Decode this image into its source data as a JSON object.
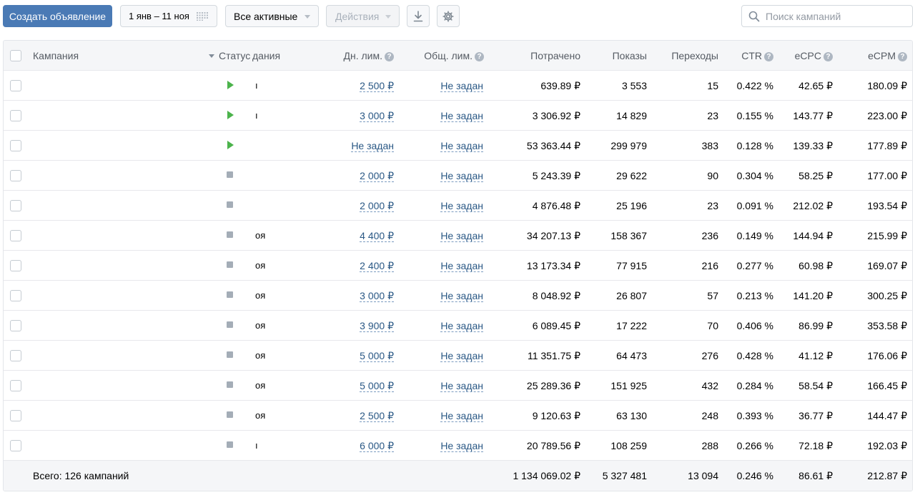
{
  "toolbar": {
    "create_label": "Создать объявление",
    "date_range": "1 янв – 11 ноя",
    "filter_label": "Все активные",
    "actions_label": "Действия",
    "search_placeholder": "Поиск кампаний"
  },
  "table": {
    "columns": {
      "campaign": "Кампания",
      "status": "Статус",
      "status_overlap": "дания",
      "daily_limit": "Дн. лим.",
      "total_limit": "Общ. лим.",
      "spent": "Потрачено",
      "impressions": "Показы",
      "clicks": "Переходы",
      "ctr": "CTR",
      "ecpc": "eCPC",
      "ecpm": "eCPM"
    },
    "help_glyph": "?",
    "rows": [
      {
        "status": "active",
        "frag": "ı",
        "daily_limit": "2 500 ₽",
        "total_limit": "Не задан",
        "spent": "639.89 ₽",
        "impressions": "3 553",
        "clicks": "15",
        "ctr": "0.422 %",
        "ecpc": "42.65 ₽",
        "ecpm": "180.09 ₽"
      },
      {
        "status": "active",
        "frag": "ı",
        "daily_limit": "3 000 ₽",
        "total_limit": "Не задан",
        "spent": "3 306.92 ₽",
        "impressions": "14 829",
        "clicks": "23",
        "ctr": "0.155 %",
        "ecpc": "143.77 ₽",
        "ecpm": "223.00 ₽"
      },
      {
        "status": "active",
        "frag": "",
        "daily_limit": "Не задан",
        "total_limit": "Не задан",
        "spent": "53 363.44 ₽",
        "impressions": "299 979",
        "clicks": "383",
        "ctr": "0.128 %",
        "ecpc": "139.33 ₽",
        "ecpm": "177.89 ₽"
      },
      {
        "status": "stopped",
        "frag": "",
        "daily_limit": "2 000 ₽",
        "total_limit": "Не задан",
        "spent": "5 243.39 ₽",
        "impressions": "29 622",
        "clicks": "90",
        "ctr": "0.304 %",
        "ecpc": "58.25 ₽",
        "ecpm": "177.00 ₽"
      },
      {
        "status": "stopped",
        "frag": "",
        "daily_limit": "2 000 ₽",
        "total_limit": "Не задан",
        "spent": "4 876.48 ₽",
        "impressions": "25 196",
        "clicks": "23",
        "ctr": "0.091 %",
        "ecpc": "212.02 ₽",
        "ecpm": "193.54 ₽"
      },
      {
        "status": "stopped",
        "frag": "оя",
        "daily_limit": "4 400 ₽",
        "total_limit": "Не задан",
        "spent": "34 207.13 ₽",
        "impressions": "158 367",
        "clicks": "236",
        "ctr": "0.149 %",
        "ecpc": "144.94 ₽",
        "ecpm": "215.99 ₽"
      },
      {
        "status": "stopped",
        "frag": "оя",
        "daily_limit": "2 400 ₽",
        "total_limit": "Не задан",
        "spent": "13 173.34 ₽",
        "impressions": "77 915",
        "clicks": "216",
        "ctr": "0.277 %",
        "ecpc": "60.98 ₽",
        "ecpm": "169.07 ₽"
      },
      {
        "status": "stopped",
        "frag": "оя",
        "daily_limit": "3 000 ₽",
        "total_limit": "Не задан",
        "spent": "8 048.92 ₽",
        "impressions": "26 807",
        "clicks": "57",
        "ctr": "0.213 %",
        "ecpc": "141.20 ₽",
        "ecpm": "300.25 ₽"
      },
      {
        "status": "stopped",
        "frag": "оя",
        "daily_limit": "3 900 ₽",
        "total_limit": "Не задан",
        "spent": "6 089.45 ₽",
        "impressions": "17 222",
        "clicks": "70",
        "ctr": "0.406 %",
        "ecpc": "86.99 ₽",
        "ecpm": "353.58 ₽"
      },
      {
        "status": "stopped",
        "frag": "оя",
        "daily_limit": "5 000 ₽",
        "total_limit": "Не задан",
        "spent": "11 351.75 ₽",
        "impressions": "64 473",
        "clicks": "276",
        "ctr": "0.428 %",
        "ecpc": "41.12 ₽",
        "ecpm": "176.06 ₽"
      },
      {
        "status": "stopped",
        "frag": "оя",
        "daily_limit": "5 000 ₽",
        "total_limit": "Не задан",
        "spent": "25 289.36 ₽",
        "impressions": "151 925",
        "clicks": "432",
        "ctr": "0.284 %",
        "ecpc": "58.54 ₽",
        "ecpm": "166.45 ₽"
      },
      {
        "status": "stopped",
        "frag": "оя",
        "daily_limit": "2 500 ₽",
        "total_limit": "Не задан",
        "spent": "9 120.63 ₽",
        "impressions": "63 130",
        "clicks": "248",
        "ctr": "0.393 %",
        "ecpc": "36.77 ₽",
        "ecpm": "144.47 ₽"
      },
      {
        "status": "stopped",
        "frag": "ı",
        "daily_limit": "6 000 ₽",
        "total_limit": "Не задан",
        "spent": "20 789.56 ₽",
        "impressions": "108 259",
        "clicks": "288",
        "ctr": "0.266 %",
        "ecpc": "72.18 ₽",
        "ecpm": "192.03 ₽"
      }
    ],
    "total": {
      "label": "Всего: 126 кампаний",
      "spent": "1 134 069.02 ₽",
      "impressions": "5 327 481",
      "clicks": "13 094",
      "ctr": "0.246 %",
      "ecpc": "86.61 ₽",
      "ecpm": "212.87 ₽"
    }
  },
  "colors": {
    "primary": "#4a7ab5",
    "link": "#2a5885",
    "active_status": "#4bb34b",
    "stopped_status": "#a4adb7"
  }
}
